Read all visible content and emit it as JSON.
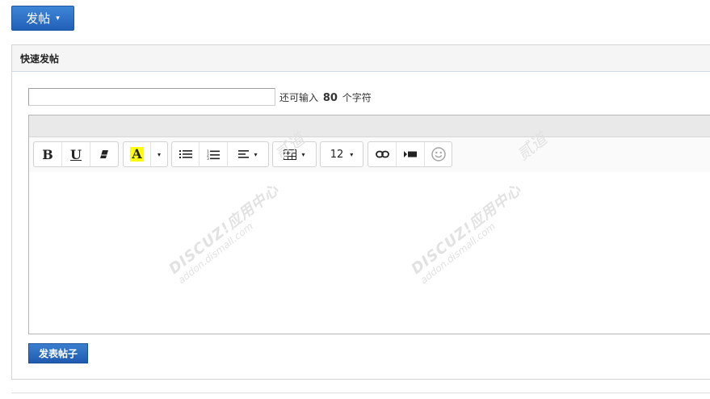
{
  "post_button": {
    "label": "发帖",
    "caret": "▾"
  },
  "panel": {
    "title": "快速发帖"
  },
  "subject": {
    "value": "",
    "placeholder": "",
    "remaining_prefix": "还可输入",
    "remaining_count": "80",
    "remaining_suffix": "个字符"
  },
  "toolbar": {
    "font_size": "12",
    "caret": "▾"
  },
  "body": {
    "value": ""
  },
  "watermark": {
    "line1": "DISCUZ!应用中心",
    "line2": "addon.dismall.com",
    "line3": "贰道"
  },
  "submit": {
    "label": "发表帖子"
  },
  "colors": {
    "primary": "#2a6bc4",
    "font_color_swatch": "#ffff00"
  },
  "icons": [
    "bold-icon",
    "underline-icon",
    "eraser-icon",
    "font-color-icon",
    "bulleted-list-icon",
    "numbered-list-icon",
    "align-icon",
    "table-icon",
    "link-icon",
    "media-icon",
    "emoji-icon"
  ]
}
